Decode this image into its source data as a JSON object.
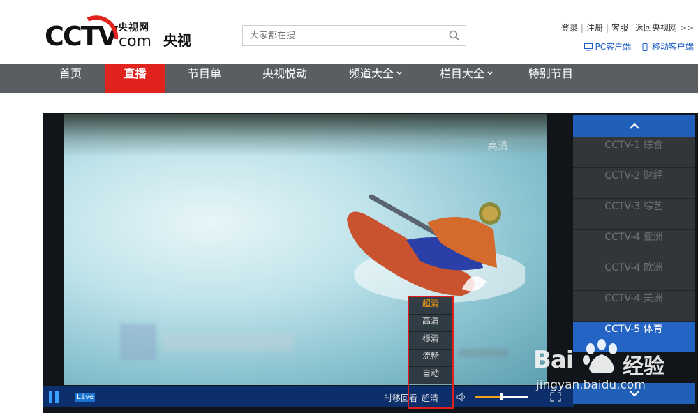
{
  "header": {
    "logo_brand": "CCTV.com",
    "logo_site": "央视网",
    "logo_name": "央视",
    "search_placeholder": "大家都在搜",
    "top_links": [
      "登录",
      "注册",
      "客服",
      "返回央视网"
    ],
    "top_links_arrow": ">>",
    "clients": [
      "PC客户端",
      "移动客户端"
    ]
  },
  "nav": {
    "items": [
      {
        "label": "首页",
        "active": false,
        "dropdown": false
      },
      {
        "label": "直播",
        "active": true,
        "dropdown": false
      },
      {
        "label": "节目单",
        "active": false,
        "dropdown": false
      },
      {
        "label": "央视悦动",
        "active": false,
        "dropdown": false
      },
      {
        "label": "频道大全",
        "active": false,
        "dropdown": true
      },
      {
        "label": "栏目大全",
        "active": false,
        "dropdown": true
      },
      {
        "label": "特别节目",
        "active": false,
        "dropdown": false
      }
    ]
  },
  "player": {
    "live_badge": "Live",
    "timeshift_label": "时移回看",
    "current_quality": "超清",
    "volume_level": 0.5,
    "quality_options": [
      "超清",
      "高清",
      "标清",
      "流畅",
      "自动"
    ],
    "selected_quality": "超清"
  },
  "channels": {
    "items": [
      "CCTV-1 综合",
      "CCTV-2 财经",
      "CCTV-3 综艺",
      "CCTV-4 亚洲",
      "CCTV-4 欧洲",
      "CCTV-4 美洲",
      "CCTV-5 体育"
    ],
    "selected": "CCTV-5 体育"
  },
  "watermark": {
    "brand_a": "Bai",
    "brand_b": "经验",
    "url": "jingyan.baidu.com"
  },
  "colors": {
    "nav_bg": "#5a5e63",
    "nav_active": "#e0231c",
    "control_bar": "#0c2f6b",
    "channel_selected": "#2464c4",
    "quality_selected": "#f39c12",
    "highlight_box": "#e01e1e"
  }
}
